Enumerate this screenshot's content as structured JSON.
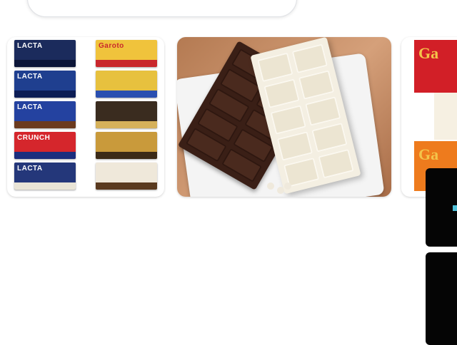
{
  "search": {
    "visible_text": "· ·  ·  · ·  · ·  ·"
  },
  "image_cards": [
    {
      "kind": "product-grid",
      "packages": [
        {
          "brand": "LACTA",
          "bg": "#1b2b5c",
          "stripe": "#0c1638",
          "label_color": "#ffffff"
        },
        {
          "brand": "Garoto",
          "bg": "#f0c33c",
          "stripe": "#c9272c",
          "label_color": "#c9272c"
        },
        {
          "brand": "LACTA",
          "bg": "#1f3f8f",
          "stripe": "#0c1d55",
          "label_color": "#ffffff"
        },
        {
          "brand": "",
          "bg": "#e7c13e",
          "stripe": "#2a4fb0",
          "label_color": "#1a1a1a"
        },
        {
          "brand": "LACTA",
          "bg": "#2442a0",
          "stripe": "#6b3a1e",
          "label_color": "#ffffff"
        },
        {
          "brand": "",
          "bg": "#3a2c1f",
          "stripe": "#d6b15a",
          "label_color": "#ffffff"
        },
        {
          "brand": "CRUNCH",
          "bg": "#d5262c",
          "stripe": "#1b2e7e",
          "label_color": "#ffffff"
        },
        {
          "brand": "",
          "bg": "#c99a3b",
          "stripe": "#3b2a17",
          "label_color": "#ffffff"
        },
        {
          "brand": "LACTA",
          "bg": "#24377a",
          "stripe": "#e9e4d6",
          "label_color": "#ffffff"
        },
        {
          "brand": "",
          "bg": "#efe8da",
          "stripe": "#5a3a1f",
          "label_color": "#5a3a1f"
        }
      ]
    },
    {
      "kind": "chocolate-bars-photo"
    },
    {
      "kind": "garoto-packages",
      "brand": "Ga"
    }
  ],
  "colors": {
    "accent_teal": "#4dc0d8",
    "page_bg": "#ffffff"
  }
}
